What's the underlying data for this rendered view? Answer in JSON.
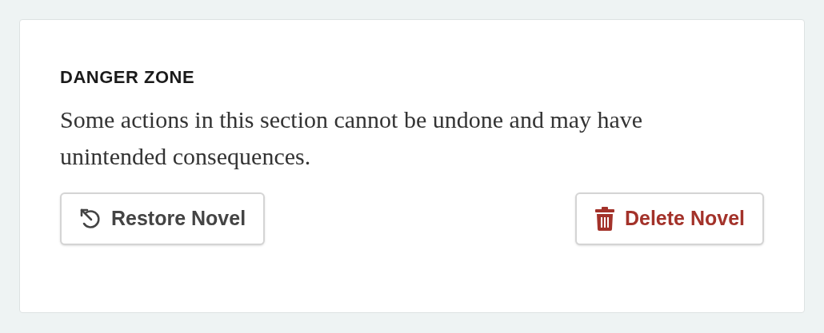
{
  "section": {
    "title": "DANGER ZONE",
    "description": "Some actions in this section cannot be undone and may have unintended consequences."
  },
  "buttons": [
    {
      "label": "Restore Novel",
      "kind": "restore"
    },
    {
      "label": "Delete Novel",
      "kind": "delete"
    }
  ]
}
